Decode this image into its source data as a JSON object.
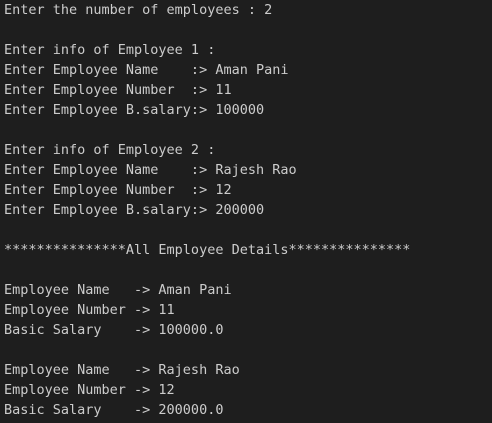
{
  "terminal": {
    "lines": [
      "Enter the number of employees : 2",
      "",
      "Enter info of Employee 1 :",
      "Enter Employee Name    :> Aman Pani",
      "Enter Employee Number  :> 11",
      "Enter Employee B.salary:> 100000",
      "",
      "Enter info of Employee 2 :",
      "Enter Employee Name    :> Rajesh Rao",
      "Enter Employee Number  :> 12",
      "Enter Employee B.salary:> 200000",
      "",
      "***************All Employee Details***************",
      "",
      "Employee Name   -> Aman Pani",
      "Employee Number -> 11",
      "Basic Salary    -> 100000.0",
      "",
      "Employee Name   -> Rajesh Rao",
      "Employee Number -> 12",
      "Basic Salary    -> 200000.0"
    ],
    "colors": {
      "background": "#1e1e1e",
      "text": "#cccccc"
    }
  }
}
